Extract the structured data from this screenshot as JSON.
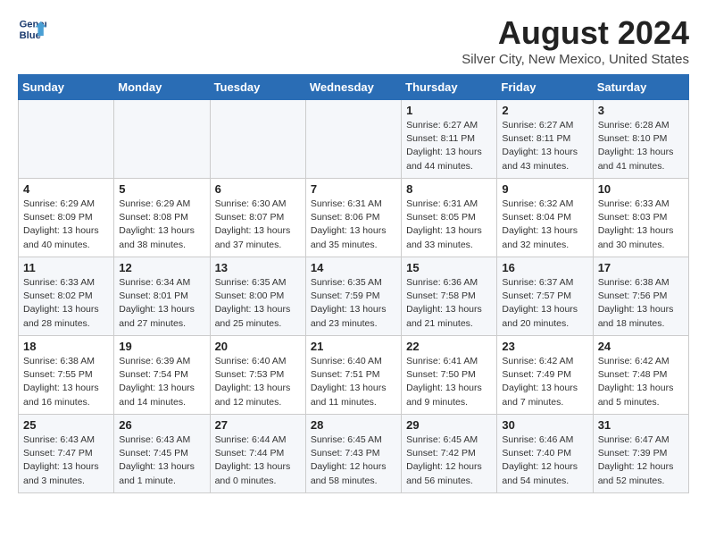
{
  "header": {
    "logo_line1": "General",
    "logo_line2": "Blue",
    "month_year": "August 2024",
    "location": "Silver City, New Mexico, United States"
  },
  "days_of_week": [
    "Sunday",
    "Monday",
    "Tuesday",
    "Wednesday",
    "Thursday",
    "Friday",
    "Saturday"
  ],
  "weeks": [
    [
      {
        "num": "",
        "info": ""
      },
      {
        "num": "",
        "info": ""
      },
      {
        "num": "",
        "info": ""
      },
      {
        "num": "",
        "info": ""
      },
      {
        "num": "1",
        "info": "Sunrise: 6:27 AM\nSunset: 8:11 PM\nDaylight: 13 hours\nand 44 minutes."
      },
      {
        "num": "2",
        "info": "Sunrise: 6:27 AM\nSunset: 8:11 PM\nDaylight: 13 hours\nand 43 minutes."
      },
      {
        "num": "3",
        "info": "Sunrise: 6:28 AM\nSunset: 8:10 PM\nDaylight: 13 hours\nand 41 minutes."
      }
    ],
    [
      {
        "num": "4",
        "info": "Sunrise: 6:29 AM\nSunset: 8:09 PM\nDaylight: 13 hours\nand 40 minutes."
      },
      {
        "num": "5",
        "info": "Sunrise: 6:29 AM\nSunset: 8:08 PM\nDaylight: 13 hours\nand 38 minutes."
      },
      {
        "num": "6",
        "info": "Sunrise: 6:30 AM\nSunset: 8:07 PM\nDaylight: 13 hours\nand 37 minutes."
      },
      {
        "num": "7",
        "info": "Sunrise: 6:31 AM\nSunset: 8:06 PM\nDaylight: 13 hours\nand 35 minutes."
      },
      {
        "num": "8",
        "info": "Sunrise: 6:31 AM\nSunset: 8:05 PM\nDaylight: 13 hours\nand 33 minutes."
      },
      {
        "num": "9",
        "info": "Sunrise: 6:32 AM\nSunset: 8:04 PM\nDaylight: 13 hours\nand 32 minutes."
      },
      {
        "num": "10",
        "info": "Sunrise: 6:33 AM\nSunset: 8:03 PM\nDaylight: 13 hours\nand 30 minutes."
      }
    ],
    [
      {
        "num": "11",
        "info": "Sunrise: 6:33 AM\nSunset: 8:02 PM\nDaylight: 13 hours\nand 28 minutes."
      },
      {
        "num": "12",
        "info": "Sunrise: 6:34 AM\nSunset: 8:01 PM\nDaylight: 13 hours\nand 27 minutes."
      },
      {
        "num": "13",
        "info": "Sunrise: 6:35 AM\nSunset: 8:00 PM\nDaylight: 13 hours\nand 25 minutes."
      },
      {
        "num": "14",
        "info": "Sunrise: 6:35 AM\nSunset: 7:59 PM\nDaylight: 13 hours\nand 23 minutes."
      },
      {
        "num": "15",
        "info": "Sunrise: 6:36 AM\nSunset: 7:58 PM\nDaylight: 13 hours\nand 21 minutes."
      },
      {
        "num": "16",
        "info": "Sunrise: 6:37 AM\nSunset: 7:57 PM\nDaylight: 13 hours\nand 20 minutes."
      },
      {
        "num": "17",
        "info": "Sunrise: 6:38 AM\nSunset: 7:56 PM\nDaylight: 13 hours\nand 18 minutes."
      }
    ],
    [
      {
        "num": "18",
        "info": "Sunrise: 6:38 AM\nSunset: 7:55 PM\nDaylight: 13 hours\nand 16 minutes."
      },
      {
        "num": "19",
        "info": "Sunrise: 6:39 AM\nSunset: 7:54 PM\nDaylight: 13 hours\nand 14 minutes."
      },
      {
        "num": "20",
        "info": "Sunrise: 6:40 AM\nSunset: 7:53 PM\nDaylight: 13 hours\nand 12 minutes."
      },
      {
        "num": "21",
        "info": "Sunrise: 6:40 AM\nSunset: 7:51 PM\nDaylight: 13 hours\nand 11 minutes."
      },
      {
        "num": "22",
        "info": "Sunrise: 6:41 AM\nSunset: 7:50 PM\nDaylight: 13 hours\nand 9 minutes."
      },
      {
        "num": "23",
        "info": "Sunrise: 6:42 AM\nSunset: 7:49 PM\nDaylight: 13 hours\nand 7 minutes."
      },
      {
        "num": "24",
        "info": "Sunrise: 6:42 AM\nSunset: 7:48 PM\nDaylight: 13 hours\nand 5 minutes."
      }
    ],
    [
      {
        "num": "25",
        "info": "Sunrise: 6:43 AM\nSunset: 7:47 PM\nDaylight: 13 hours\nand 3 minutes."
      },
      {
        "num": "26",
        "info": "Sunrise: 6:43 AM\nSunset: 7:45 PM\nDaylight: 13 hours\nand 1 minute."
      },
      {
        "num": "27",
        "info": "Sunrise: 6:44 AM\nSunset: 7:44 PM\nDaylight: 13 hours\nand 0 minutes."
      },
      {
        "num": "28",
        "info": "Sunrise: 6:45 AM\nSunset: 7:43 PM\nDaylight: 12 hours\nand 58 minutes."
      },
      {
        "num": "29",
        "info": "Sunrise: 6:45 AM\nSunset: 7:42 PM\nDaylight: 12 hours\nand 56 minutes."
      },
      {
        "num": "30",
        "info": "Sunrise: 6:46 AM\nSunset: 7:40 PM\nDaylight: 12 hours\nand 54 minutes."
      },
      {
        "num": "31",
        "info": "Sunrise: 6:47 AM\nSunset: 7:39 PM\nDaylight: 12 hours\nand 52 minutes."
      }
    ]
  ]
}
